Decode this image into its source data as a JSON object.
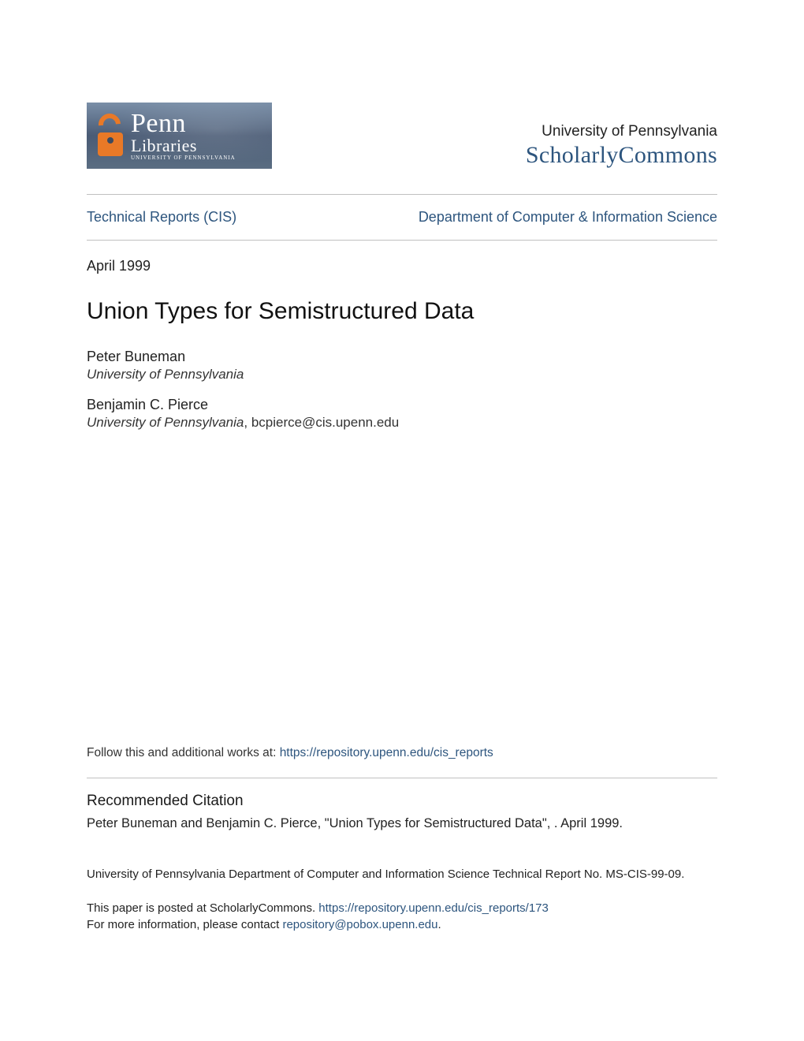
{
  "header": {
    "logo": {
      "line1": "Penn",
      "line2": "Libraries",
      "subline": "University of Pennsylvania"
    },
    "university": "University of Pennsylvania",
    "repository": "ScholarlyCommons"
  },
  "nav": {
    "left": "Technical Reports (CIS)",
    "right": "Department of Computer & Information Science"
  },
  "meta": {
    "date": "April 1999",
    "title": "Union Types for Semistructured Data"
  },
  "authors": [
    {
      "name": "Peter Buneman",
      "affiliation": "University of Pennsylvania",
      "email": ""
    },
    {
      "name": "Benjamin C. Pierce",
      "affiliation": "University of Pennsylvania",
      "email": "bcpierce@cis.upenn.edu"
    }
  ],
  "follow": {
    "prefix": "Follow this and additional works at: ",
    "link_text": "https://repository.upenn.edu/cis_reports"
  },
  "citation": {
    "heading": "Recommended Citation",
    "text": "Peter Buneman and Benjamin C. Pierce, \"Union Types for Semistructured Data\", . April 1999."
  },
  "technote": "University of Pennsylvania Department of Computer and Information Science Technical Report No. MS-CIS-99-09.",
  "footer": {
    "posted_prefix": "This paper is posted at ScholarlyCommons. ",
    "posted_link": "https://repository.upenn.edu/cis_reports/173",
    "info_prefix": "For more information, please contact ",
    "info_email": "repository@pobox.upenn.edu",
    "period": "."
  }
}
